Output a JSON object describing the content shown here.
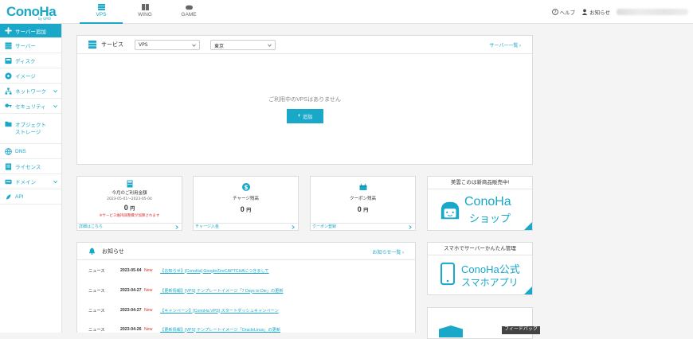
{
  "logo": {
    "text": "ConoHa",
    "sub": "by GMO"
  },
  "product_tabs": [
    {
      "label": "VPS",
      "active": true
    },
    {
      "label": "WING",
      "active": false
    },
    {
      "label": "GAME",
      "active": false
    }
  ],
  "topbar": {
    "help": "ヘルプ",
    "notice": "お知らせ"
  },
  "sidebar": {
    "items": [
      {
        "label": "サーバー追加",
        "icon": "plus-icon",
        "primary": true
      },
      {
        "label": "サーバー",
        "icon": "server-icon"
      },
      {
        "label": "ディスク",
        "icon": "disk-icon"
      },
      {
        "label": "イメージ",
        "icon": "image-icon"
      },
      {
        "label": "ネットワーク",
        "icon": "network-icon",
        "expand": true
      },
      {
        "label": "セキュリティ",
        "icon": "key-icon",
        "expand": true
      },
      {
        "label": "オブジェクト\nストレージ",
        "icon": "folder-icon"
      },
      {
        "label": "DNS",
        "icon": "dns-icon"
      },
      {
        "label": "ライセンス",
        "icon": "license-icon"
      },
      {
        "label": "ドメイン",
        "icon": "domain-icon",
        "expand": true
      },
      {
        "label": "API",
        "icon": "api-icon"
      }
    ]
  },
  "service": {
    "title": "サービス",
    "select_service": "VPS",
    "select_region": "東京",
    "server_list_link": "サーバー一覧",
    "empty_message": "ご利用中のVPSはありません",
    "add_button": "追加"
  },
  "billing": {
    "title": "今月のご利用金額",
    "period": "2023-05-01～2023-05-04",
    "amount": "0",
    "unit": "円",
    "warning": "※サービス維持調整費が加算されます",
    "link": "詳細はこちら"
  },
  "charge": {
    "title": "チャージ残高",
    "amount": "0",
    "unit": "円",
    "link": "チャージ入金"
  },
  "coupon": {
    "title": "クーポン残高",
    "amount": "0",
    "unit": "円",
    "link": "クーポン登録"
  },
  "ads": [
    {
      "header": "美雲このは新商品販売中!",
      "line1": "ConoHa",
      "line2": "ショップ"
    },
    {
      "header": "スマホでサーバーかんたん管理",
      "line1": "ConoHa公式",
      "line2": "スマホアプリ"
    }
  ],
  "news": {
    "title": "お知らせ",
    "list_link": "お知らせ一覧",
    "items": [
      {
        "category": "ニュース",
        "date": "2023-05-04",
        "new": "New",
        "title": "【お知らせ】[ConoHa] GoogleのreCAPTCHAにつきまして"
      },
      {
        "category": "ニュース",
        "date": "2023-04-27",
        "new": "New",
        "title": "【更新情報】[VPS] テンプレートイメージ「7 Days to Die」の更新"
      },
      {
        "category": "ニュース",
        "date": "2023-04-27",
        "new": "New",
        "title": "【キャンペーン】[ConoHa VPS] スタートダッシュキャンペーン"
      },
      {
        "category": "ニュース",
        "date": "2023-04-26",
        "new": "New",
        "title": "【更新情報】[VPS] テンプレートイメージ「OracleLinux」の更新"
      }
    ]
  },
  "feedback": {
    "label": "フィードバック"
  },
  "colors": {
    "accent": "#1aa8c8",
    "new": "#dd3333",
    "bg": "#f4f4f4"
  }
}
